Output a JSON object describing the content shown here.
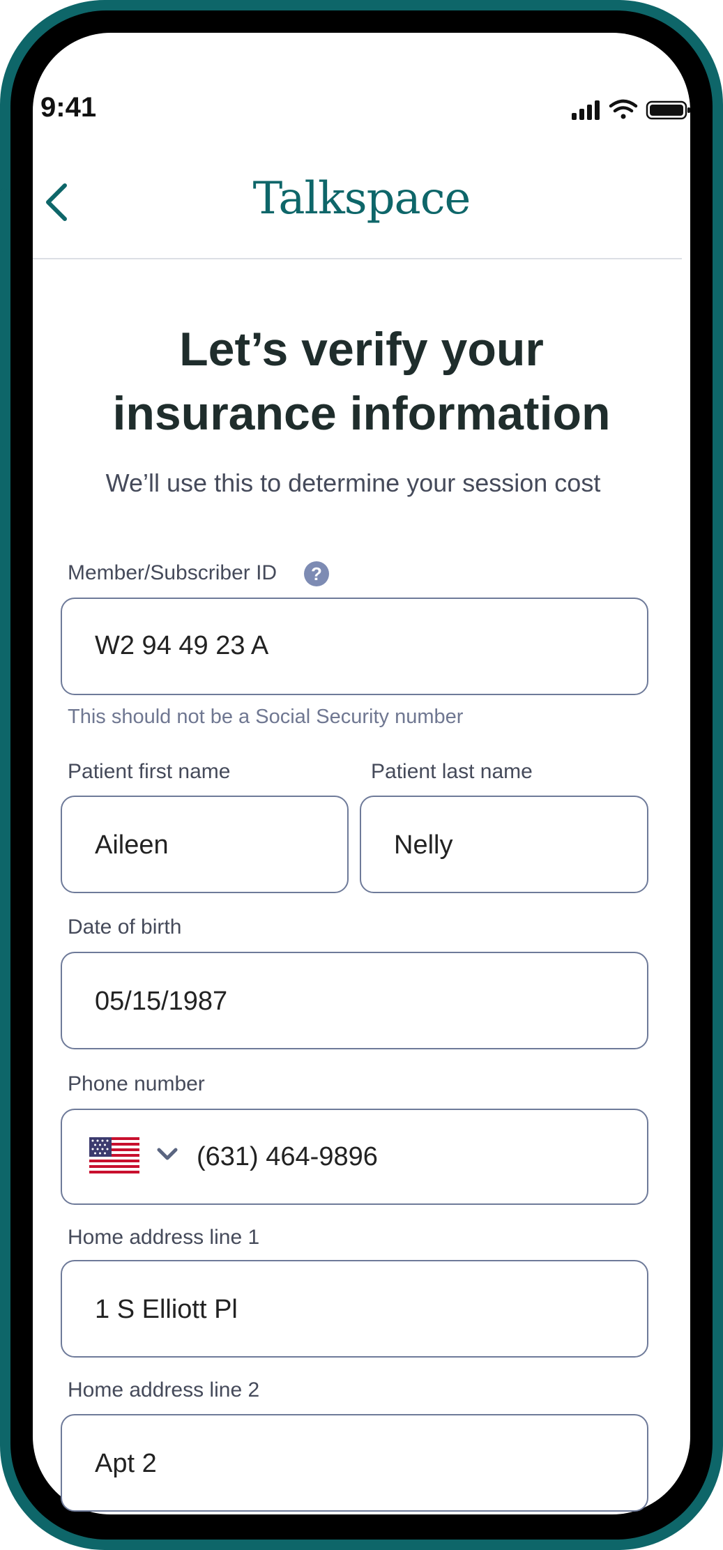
{
  "status_bar": {
    "time": "9:41"
  },
  "header": {
    "logo_text": "Talkspace"
  },
  "page": {
    "title_line1": "Let’s verify your",
    "title_line2": "insurance information",
    "subtitle": "We’ll use this to determine your session cost"
  },
  "form": {
    "member_id": {
      "label": "Member/Subscriber ID",
      "value": "W2 94 49 23 A",
      "help_glyph": "?",
      "hint": "This should not be a Social Security number"
    },
    "first_name": {
      "label": "Patient first name",
      "value": "Aileen"
    },
    "last_name": {
      "label": "Patient last name",
      "value": "Nelly"
    },
    "dob": {
      "label": "Date of birth",
      "value": "05/15/1987"
    },
    "phone": {
      "label": "Phone number",
      "value": "(631) 464-9896",
      "country_flag": "us-flag-icon"
    },
    "address1": {
      "label": "Home address line 1",
      "value": "1 S Elliott Pl"
    },
    "address2": {
      "label": "Home address line 2",
      "value": "Apt 2"
    }
  },
  "colors": {
    "brand": "#0e6669",
    "field_border": "#6e7a99",
    "text_dark": "#1f2d2c"
  }
}
